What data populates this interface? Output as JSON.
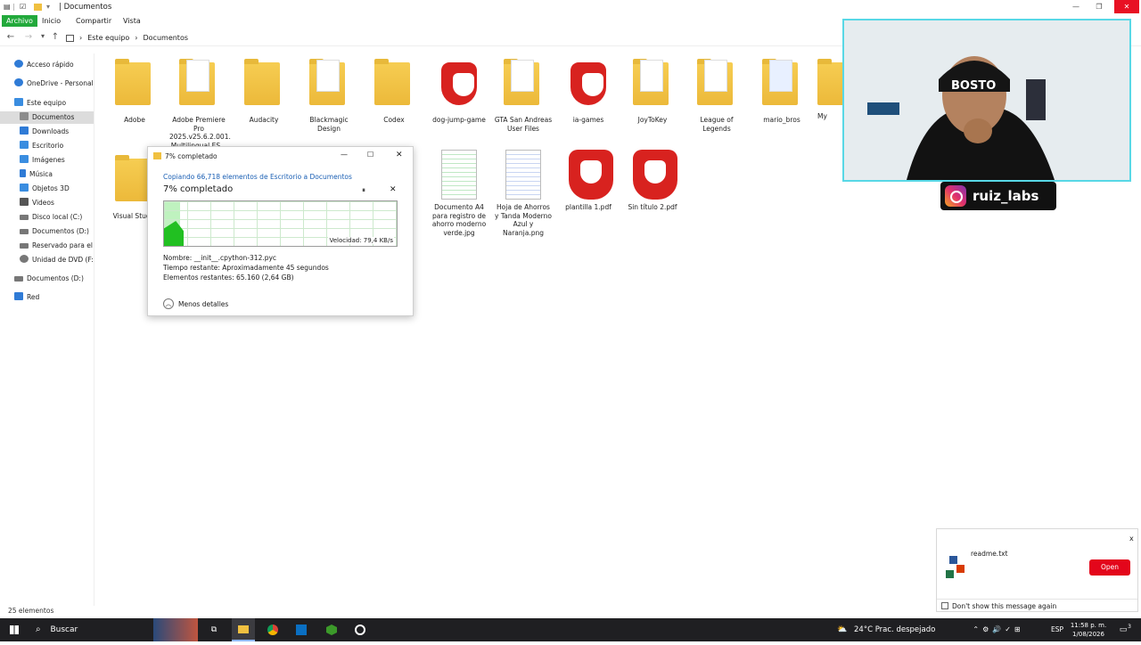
{
  "window": {
    "title": "Documentos",
    "title_prefix": "|",
    "controls": {
      "minimize": "—",
      "maximize": "❐",
      "close": "✕"
    }
  },
  "ribbon": {
    "tabs": [
      {
        "label": "Archivo",
        "active": true
      },
      {
        "label": "Inicio"
      },
      {
        "label": "Compartir"
      },
      {
        "label": "Vista"
      }
    ]
  },
  "address": {
    "crumbs": [
      "Este equipo",
      "Documentos"
    ],
    "separator": "›"
  },
  "sidebar": {
    "items": [
      {
        "label": "Acceso rápido",
        "icon": "star-icon",
        "color": "#2f7bd6"
      },
      {
        "label": "OneDrive - Personal",
        "icon": "cloud-icon",
        "color": "#2f7bd6"
      },
      {
        "label": "Este equipo",
        "icon": "computer-icon",
        "color": "#3a8de0"
      },
      {
        "label": "Documentos",
        "icon": "documents-icon",
        "color": "#8c8c8c",
        "selected": true
      },
      {
        "label": "Downloads",
        "icon": "download-icon",
        "color": "#2f7bd6"
      },
      {
        "label": "Escritorio",
        "icon": "desktop-icon",
        "color": "#3a8de0"
      },
      {
        "label": "Imágenes",
        "icon": "pictures-icon",
        "color": "#3a8de0"
      },
      {
        "label": "Música",
        "icon": "music-icon",
        "color": "#2f7bd6"
      },
      {
        "label": "Objetos 3D",
        "icon": "cube-icon",
        "color": "#3a8de0"
      },
      {
        "label": "Videos",
        "icon": "video-icon",
        "color": "#555"
      },
      {
        "label": "Disco local (C:)",
        "icon": "drive-icon",
        "color": "#777"
      },
      {
        "label": "Documentos (D:)",
        "icon": "drive-icon",
        "color": "#777"
      },
      {
        "label": "Reservado para el si",
        "icon": "drive-icon",
        "color": "#777"
      },
      {
        "label": "Unidad de DVD (F:)",
        "icon": "dvd-icon",
        "color": "#777"
      },
      {
        "label": "Documentos (D:)",
        "icon": "drive-icon",
        "color": "#777"
      },
      {
        "label": "Red",
        "icon": "network-icon",
        "color": "#2f7bd6"
      }
    ]
  },
  "files": [
    {
      "name": "Adobe",
      "kind": "folder"
    },
    {
      "name": "Adobe Premiere Pro 2025.v25.6.2.001. Multilingual.ES...",
      "kind": "folder-doc"
    },
    {
      "name": "Audacity",
      "kind": "folder"
    },
    {
      "name": "Blackmagic Design",
      "kind": "folder-doc"
    },
    {
      "name": "Codex",
      "kind": "folder"
    },
    {
      "name": "dog-jump-game",
      "kind": "brave"
    },
    {
      "name": "GTA San Andreas User Files",
      "kind": "folder-doc"
    },
    {
      "name": "ia-games",
      "kind": "brave"
    },
    {
      "name": "JoyToKey",
      "kind": "folder-doc"
    },
    {
      "name": "League of Legends",
      "kind": "folder-doc"
    },
    {
      "name": "mario_bros",
      "kind": "folder-doc"
    },
    {
      "name": "My",
      "kind": "folder"
    },
    {
      "name": "Visual Studio",
      "kind": "folder"
    },
    {
      "name": "Documento A4 para registro de ahorro moderno verde.jpg",
      "kind": "sheet-green"
    },
    {
      "name": "Hoja de Ahorros y Tanda Moderno Azul y Naranja.png",
      "kind": "sheet-blue"
    },
    {
      "name": "plantilla 1.pdf",
      "kind": "brave"
    },
    {
      "name": "Sin título 2.pdf",
      "kind": "brave"
    }
  ],
  "copy_dialog": {
    "title": "7% completado",
    "copy_line": "Copiando 66,718 elementos de Escritorio a Documentos",
    "progress_label": "7% completado",
    "progress_fraction": 0.07,
    "pause": "⏸",
    "cancel": "✕",
    "speed": "Velocidad: 79,4 KB/s",
    "name_line": "Nombre: __init__.cpython-312.pyc",
    "time_line": "Tiempo restante: Aproximadamente 45 segundos",
    "items_line": "Elementos restantes: 65.160 (2,64 GB)",
    "less_details": "Menos detalles",
    "controls": {
      "minimize": "—",
      "maximize": "☐",
      "close": "✕"
    }
  },
  "overlay": {
    "handle": "ruiz_labs"
  },
  "notification": {
    "file": "readme.txt",
    "open": "Open",
    "dont_show": "Don't show this message again",
    "close": "x"
  },
  "statusbar": {
    "count": "25 elementos"
  },
  "taskbar": {
    "search": "Buscar",
    "weather": "24°C  Prac. despejado",
    "lang": "ESP",
    "time": "11:58 p. m.",
    "date": "1/08/2026",
    "notif_count": "3"
  },
  "colors": {
    "accent": "#22a93b",
    "brave": "#d8221f",
    "open_button": "#e3061b"
  }
}
